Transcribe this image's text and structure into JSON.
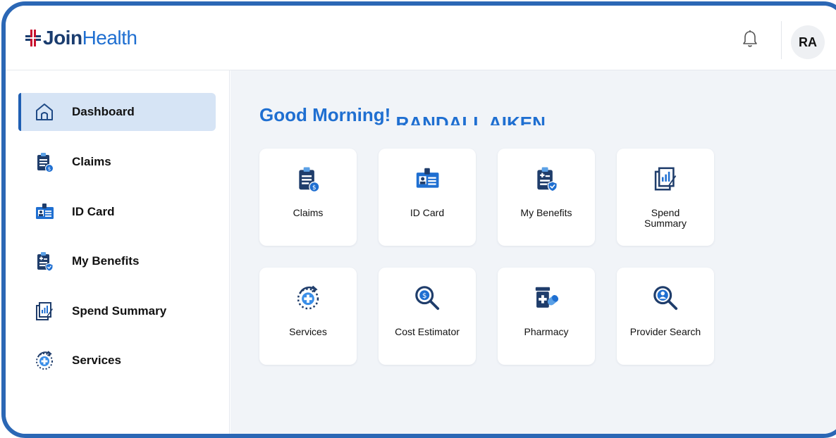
{
  "brand": {
    "name_part1": "Join",
    "name_part2": "Health"
  },
  "header": {
    "avatar_initials": "RA",
    "notification_icon": "bell-icon"
  },
  "sidebar": {
    "items": [
      {
        "label": "Dashboard",
        "icon": "home-icon",
        "active": true
      },
      {
        "label": "Claims",
        "icon": "claims-icon",
        "active": false
      },
      {
        "label": "ID Card",
        "icon": "id-card-icon",
        "active": false
      },
      {
        "label": "My Benefits",
        "icon": "benefits-icon",
        "active": false
      },
      {
        "label": "Spend Summary",
        "icon": "spend-summary-icon",
        "active": false
      },
      {
        "label": "Services",
        "icon": "services-icon",
        "active": false
      }
    ]
  },
  "main": {
    "greeting": "Good Morning!",
    "user_name": "RANDALL AIKEN",
    "tiles": [
      {
        "label": "Claims",
        "icon": "claims-icon"
      },
      {
        "label": "ID Card",
        "icon": "id-card-icon"
      },
      {
        "label": "My Benefits",
        "icon": "benefits-icon"
      },
      {
        "label": "Spend Summary",
        "icon": "spend-summary-icon"
      },
      {
        "label": "Services",
        "icon": "services-icon"
      },
      {
        "label": "Cost Estimator",
        "icon": "cost-estimator-icon"
      },
      {
        "label": "Pharmacy",
        "icon": "pharmacy-icon"
      },
      {
        "label": "Provider Search",
        "icon": "provider-search-icon"
      }
    ]
  },
  "colors": {
    "brand_dark": "#1a3c6e",
    "brand_blue": "#1f6fd1",
    "active_bg": "#d6e4f5",
    "main_bg": "#f1f4f8",
    "frame_border": "#2b67b5"
  }
}
